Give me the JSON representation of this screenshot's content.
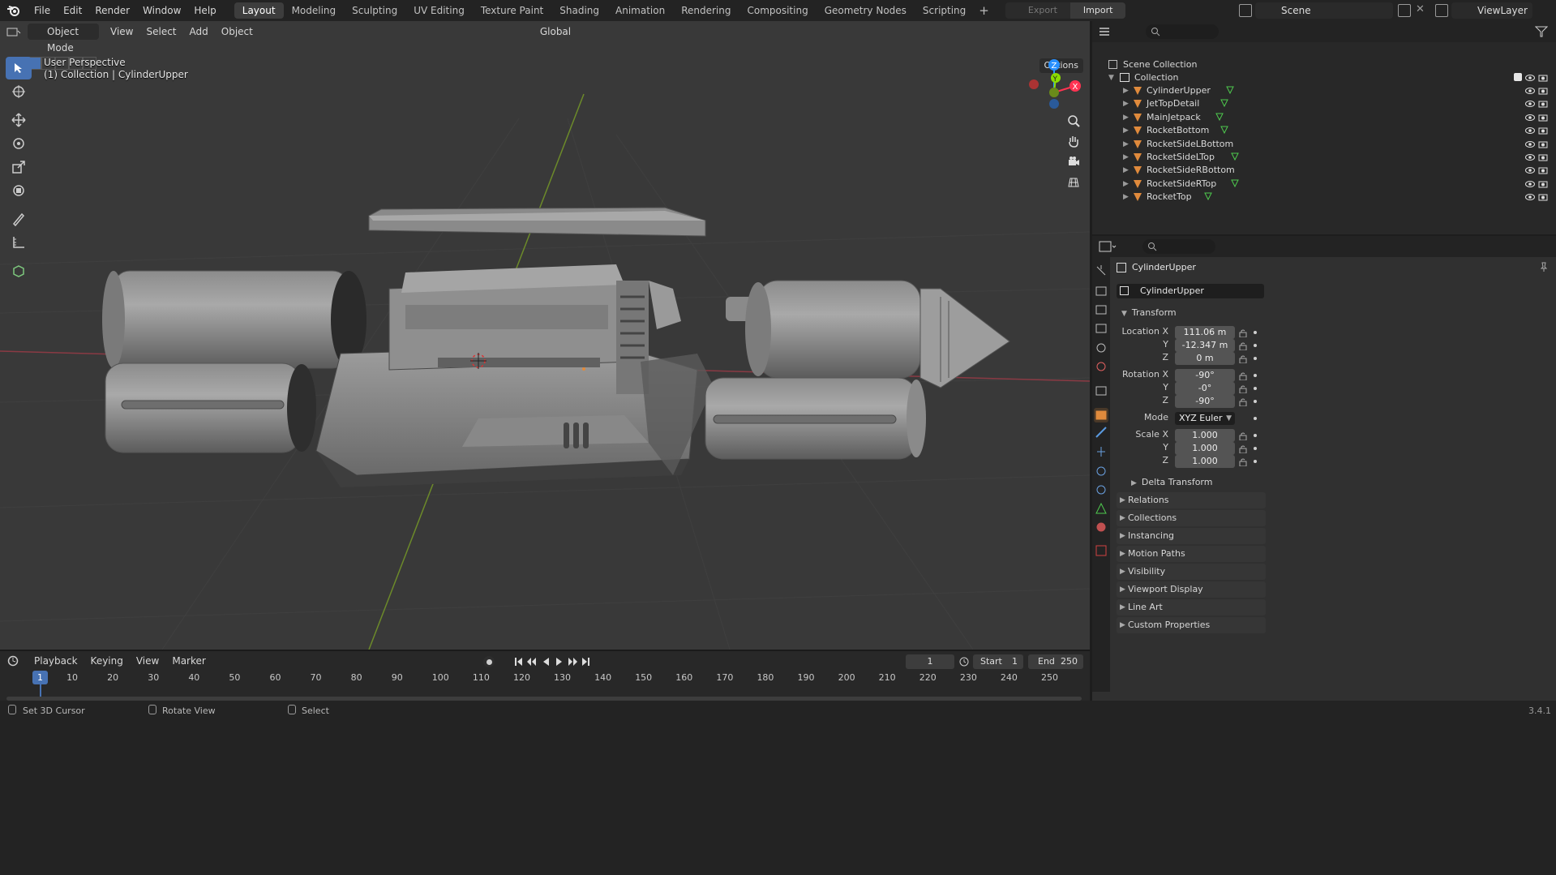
{
  "topbar": {
    "menus": [
      "File",
      "Edit",
      "Render",
      "Window",
      "Help"
    ],
    "workspaces": [
      "Layout",
      "Modeling",
      "Sculpting",
      "UV Editing",
      "Texture Paint",
      "Shading",
      "Animation",
      "Rendering",
      "Compositing",
      "Geometry Nodes",
      "Scripting"
    ],
    "active_workspace": "Layout",
    "add_workspace": "+",
    "export_label": "Export",
    "import_label": "Import",
    "scene_name": "Scene",
    "view_layer_name": "ViewLayer"
  },
  "viewport": {
    "mode": "Object Mode",
    "menus": [
      "View",
      "Select",
      "Add",
      "Object"
    ],
    "orientation": "Global",
    "view_name": "User Perspective",
    "context": "(1) Collection | CylinderUpper",
    "options_label": "Options",
    "gizmo": {
      "z": "Z",
      "y": "Y",
      "x": "X"
    }
  },
  "outliner": {
    "root": "Scene Collection",
    "collection": "Collection",
    "objects": [
      {
        "name": "CylinderUpper",
        "has_mesh": true
      },
      {
        "name": "JetTopDetail",
        "has_mesh": true
      },
      {
        "name": "MainJetpack",
        "has_mesh": true
      },
      {
        "name": "RocketBottom",
        "has_mesh": true
      },
      {
        "name": "RocketSideLBottom",
        "has_mesh": false
      },
      {
        "name": "RocketSideLTop",
        "has_mesh": true
      },
      {
        "name": "RocketSideRBottom",
        "has_mesh": false
      },
      {
        "name": "RocketSideRTop",
        "has_mesh": true
      },
      {
        "name": "RocketTop",
        "has_mesh": true
      }
    ]
  },
  "properties": {
    "object_name": "CylinderUpper",
    "object_datablock": "CylinderUpper",
    "transform_label": "Transform",
    "location": {
      "label": "Location X",
      "x": "111.06 m",
      "y": "-12.347 m",
      "z": "0 m"
    },
    "rotation": {
      "label": "Rotation X",
      "x": "-90°",
      "y": "-0°",
      "z": "-90°"
    },
    "mode_label": "Mode",
    "mode_value": "XYZ Euler",
    "scale": {
      "label": "Scale X",
      "x": "1.000",
      "y": "1.000",
      "z": "1.000"
    },
    "axis_y": "Y",
    "axis_z": "Z",
    "delta_transform": "Delta Transform",
    "panels": [
      "Relations",
      "Collections",
      "Instancing",
      "Motion Paths",
      "Visibility",
      "Viewport Display",
      "Line Art",
      "Custom Properties"
    ]
  },
  "timeline": {
    "menus": [
      "Playback",
      "Keying",
      "View",
      "Marker"
    ],
    "current_frame": "1",
    "start_label": "Start",
    "start_value": "1",
    "end_label": "End",
    "end_value": "250",
    "ruler": [
      "1",
      "10",
      "20",
      "30",
      "40",
      "50",
      "60",
      "70",
      "80",
      "90",
      "100",
      "110",
      "120",
      "130",
      "140",
      "150",
      "160",
      "170",
      "180",
      "190",
      "200",
      "210",
      "220",
      "230",
      "240",
      "250"
    ]
  },
  "statusbar": {
    "items": [
      "Set 3D Cursor",
      "Rotate View",
      "Select"
    ],
    "version": "3.4.1"
  },
  "colors": {
    "accent": "#4772b3",
    "object_orange": "#e08a3c",
    "mesh_green": "#4ec94e",
    "axis_x": "#ff3352",
    "axis_y": "#8bdc00",
    "axis_z": "#2890ff"
  }
}
